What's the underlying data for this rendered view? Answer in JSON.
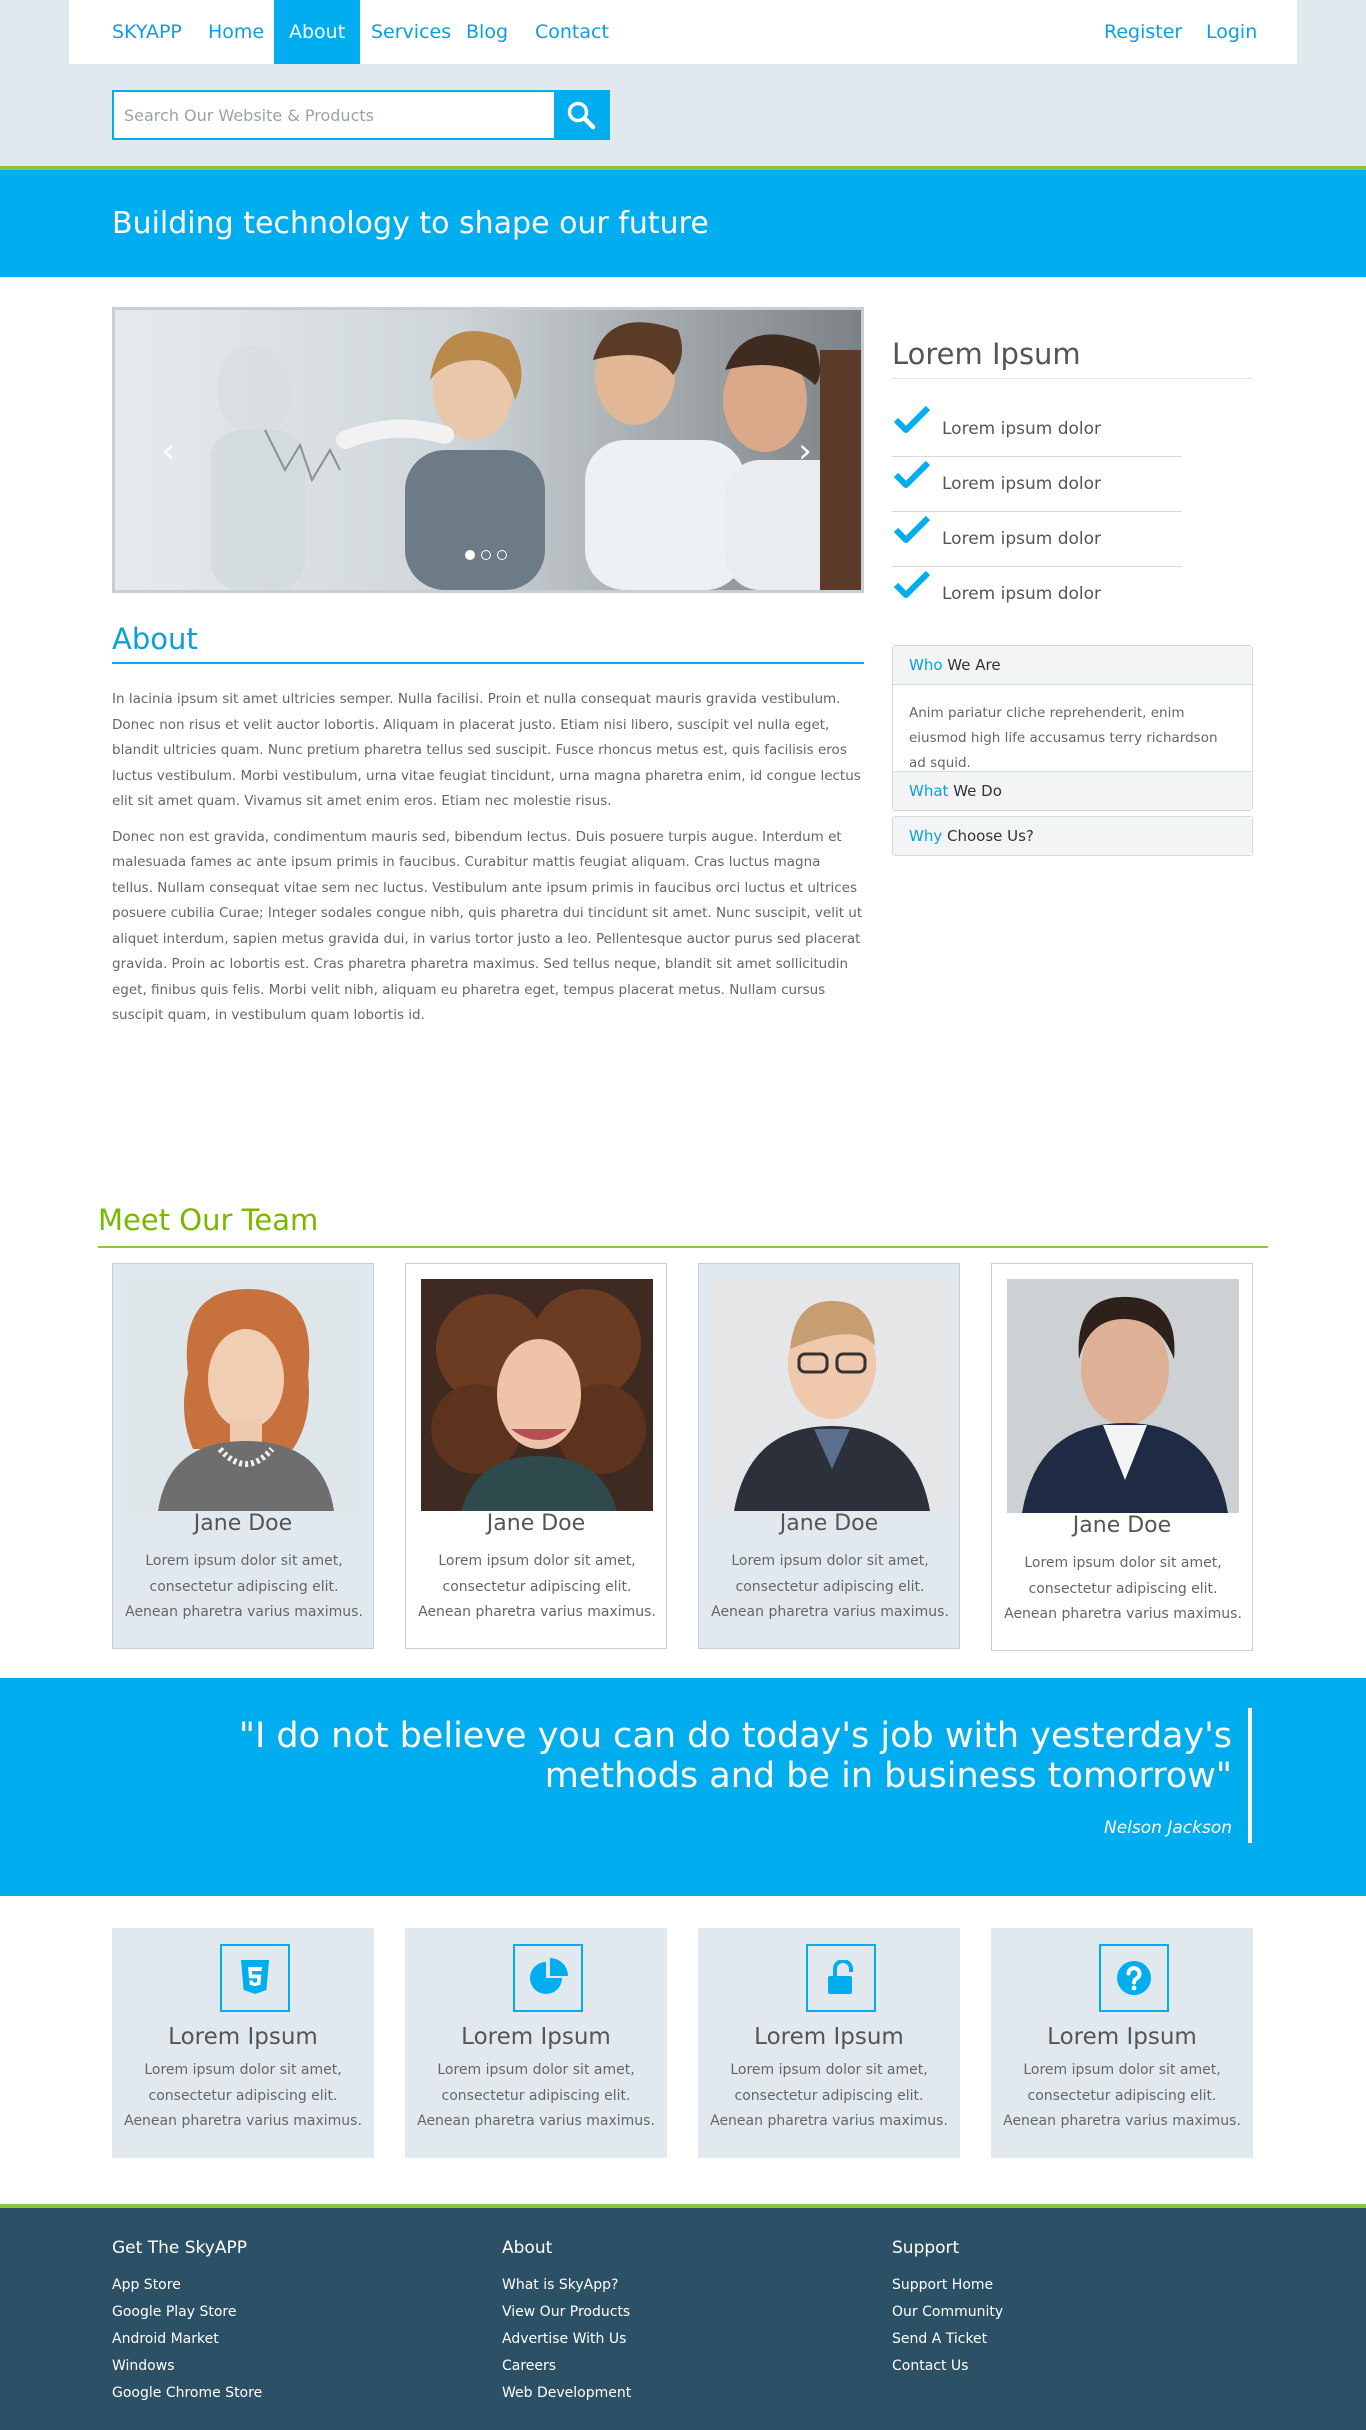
{
  "nav": {
    "brand": "SKYAPP",
    "items": [
      {
        "label": "Home"
      },
      {
        "label": "About"
      },
      {
        "label": "Services"
      },
      {
        "label": "Blog"
      },
      {
        "label": "Contact"
      }
    ],
    "active": "About",
    "register": "Register",
    "login": "Login"
  },
  "search": {
    "placeholder": "Search Our Website & Products",
    "value": ""
  },
  "banner": {
    "headline": "Building technology to shape our future"
  },
  "carousel": {
    "slide_count": 3,
    "active_slide": 1
  },
  "about": {
    "title": "About",
    "paragraphs": [
      "In lacinia ipsum sit amet ultricies semper. Nulla facilisi. Proin et nulla consequat mauris gravida vestibulum. Donec non risus et velit auctor lobortis. Aliquam in placerat justo. Etiam nisi libero, suscipit vel nulla eget, blandit ultricies quam. Nunc pretium pharetra tellus sed suscipit. Fusce rhoncus metus est, quis facilisis eros luctus vestibulum. Morbi vestibulum, urna vitae feugiat tincidunt, urna magna pharetra enim, id congue lectus elit sit amet quam. Vivamus sit amet enim eros. Etiam nec molestie risus.",
      "Donec non est gravida, condimentum mauris sed, bibendum lectus. Duis posuere turpis augue. Interdum et malesuada fames ac ante ipsum primis in faucibus. Curabitur mattis feugiat aliquam. Cras luctus magna tellus. Nullam consequat vitae sem nec luctus. Vestibulum ante ipsum primis in faucibus orci luctus et ultrices posuere cubilia Curae; Integer sodales congue nibh, quis pharetra dui tincidunt sit amet. Nunc suscipit, velit ut aliquet interdum, sapien metus gravida dui, in varius tortor justo a leo. Pellentesque auctor purus sed placerat gravida. Proin ac lobortis est. Cras pharetra pharetra maximus. Sed tellus neque, blandit sit amet sollicitudin eget, finibus quis felis. Morbi velit nibh, aliquam eu pharetra eget, tempus placerat metus. Nullam cursus suscipit quam, in vestibulum quam lobortis id."
    ]
  },
  "sidebar": {
    "title": "Lorem Ipsum",
    "checklist": [
      "Lorem ipsum dolor",
      "Lorem ipsum dolor",
      "Lorem ipsum dolor",
      "Lorem ipsum dolor"
    ],
    "accordion": [
      {
        "highlight": "Who",
        "rest": " We Are",
        "body": "Anim pariatur cliche reprehenderit, enim eiusmod high life accusamus terry richardson ad squid.",
        "expanded": true
      },
      {
        "highlight": "What",
        "rest": " We Do",
        "body": "",
        "expanded": false
      },
      {
        "highlight": "Why",
        "rest": " Choose Us?",
        "body": "",
        "expanded": false
      }
    ]
  },
  "team": {
    "title": "Meet Our Team",
    "members": [
      {
        "name": "Jane Doe",
        "desc": "Lorem ipsum dolor sit amet, consectetur adipiscing elit. Aenean pharetra varius maximus."
      },
      {
        "name": "Jane Doe",
        "desc": "Lorem ipsum dolor sit amet, consectetur adipiscing elit. Aenean pharetra varius maximus."
      },
      {
        "name": "Jane Doe",
        "desc": "Lorem ipsum dolor sit amet, consectetur adipiscing elit. Aenean pharetra varius maximus."
      },
      {
        "name": "Jane Doe",
        "desc": "Lorem ipsum dolor sit amet, consectetur adipiscing elit. Aenean pharetra varius maximus."
      }
    ]
  },
  "quote": {
    "text": "\"I do not believe you can do today's job with yesterday's methods and be in business tomorrow\"",
    "author": "Nelson Jackson"
  },
  "features": [
    {
      "icon": "html5-icon",
      "title": "Lorem Ipsum",
      "desc": "Lorem ipsum dolor sit amet, consectetur adipiscing elit. Aenean pharetra varius maximus."
    },
    {
      "icon": "pie-chart-icon",
      "title": "Lorem Ipsum",
      "desc": "Lorem ipsum dolor sit amet, consectetur adipiscing elit. Aenean pharetra varius maximus."
    },
    {
      "icon": "unlock-icon",
      "title": "Lorem Ipsum",
      "desc": "Lorem ipsum dolor sit amet, consectetur adipiscing elit. Aenean pharetra varius maximus."
    },
    {
      "icon": "question-circle-icon",
      "title": "Lorem Ipsum",
      "desc": "Lorem ipsum dolor sit amet, consectetur adipiscing elit. Aenean pharetra varius maximus."
    }
  ],
  "footer": {
    "columns": [
      {
        "title": "Get The SkyAPP",
        "links": [
          "App Store",
          "Google Play Store",
          "Android Market",
          "Windows",
          "Google Chrome Store"
        ]
      },
      {
        "title": "About",
        "links": [
          "What is SkyApp?",
          "View Our Products",
          "Advertise With Us",
          "Careers",
          "Web Development"
        ]
      },
      {
        "title": "Support",
        "links": [
          "Support Home",
          "Our Community",
          "Send A Ticket",
          "Contact Us"
        ]
      }
    ]
  },
  "colors": {
    "primary": "#00adef",
    "accent_green": "#8cc63f",
    "light_bg": "#e2e9ee",
    "footer_bg": "#2c5065"
  }
}
